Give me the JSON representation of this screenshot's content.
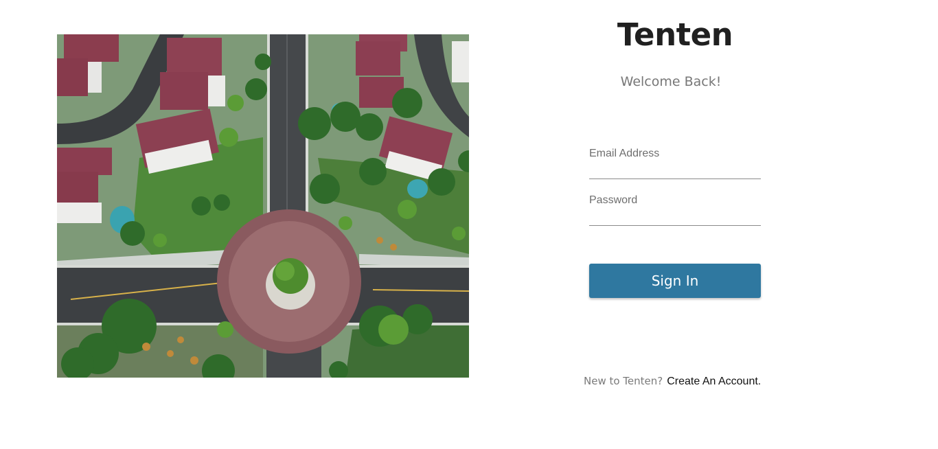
{
  "brand": {
    "name": "Tenten"
  },
  "welcome": {
    "text": "Welcome Back!"
  },
  "form": {
    "email": {
      "label": "Email Address",
      "value": ""
    },
    "password": {
      "label": "Password",
      "value": ""
    },
    "submit_label": "Sign In"
  },
  "signup": {
    "question": "New to Tenten?",
    "link_label": "Create An Account."
  },
  "hero": {
    "icon": "aerial-neighborhood-photo"
  },
  "colors": {
    "primary_button": "#2f78a0",
    "title": "#202020",
    "muted_text": "#777777"
  }
}
